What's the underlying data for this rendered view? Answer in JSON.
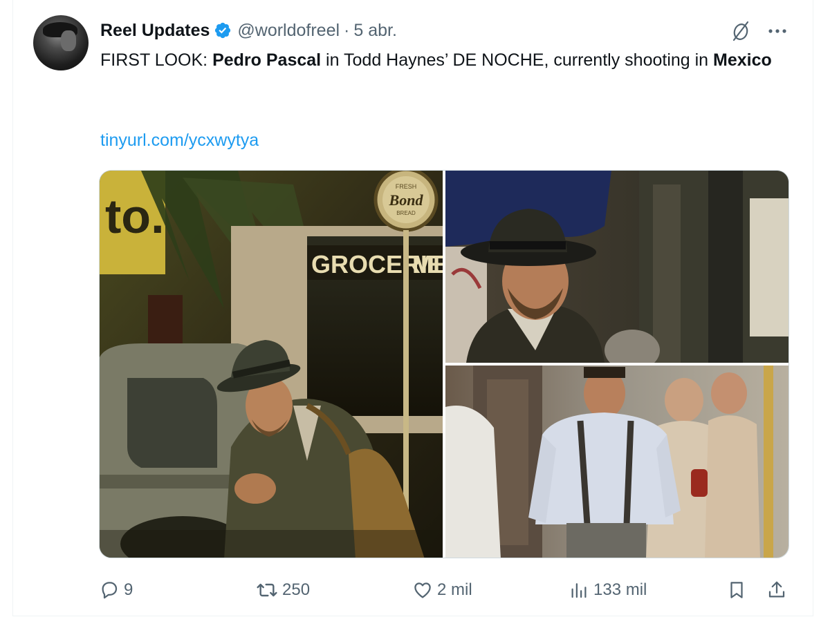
{
  "author": {
    "name": "Reel Updates",
    "handle": "@worldofreel",
    "separator": "·",
    "date": "5 abr.",
    "verified": true,
    "badge_color": "#1d9bf0",
    "avatar_icon": "avatar-image"
  },
  "tweet": {
    "text_parts": [
      {
        "text": "FIRST LOOK: ",
        "bold": false
      },
      {
        "text": "Pedro Pascal",
        "bold": true
      },
      {
        "text": " in Todd Haynes’ DE NOCHE, currently shooting in ",
        "bold": false
      },
      {
        "text": "Mexico",
        "bold": true
      }
    ],
    "link": "tinyurl.com/ycxwytya",
    "link_color": "#1d9bf0"
  },
  "media": {
    "photos": [
      {
        "label": "photo-left",
        "sign_text_1": "GROCERIES",
        "sign_text_2": "ME",
        "round_sign": "Bond",
        "round_sign_top": "FRESH",
        "round_sign_bottom": "BREAD"
      },
      {
        "label": "photo-top-right"
      },
      {
        "label": "photo-bottom-right"
      }
    ]
  },
  "actions": {
    "reply": {
      "icon": "reply-icon",
      "count": "9"
    },
    "retweet": {
      "icon": "retweet-icon",
      "count": "250"
    },
    "like": {
      "icon": "heart-icon",
      "count": "2 mil"
    },
    "views": {
      "icon": "views-icon",
      "count": "133 mil"
    },
    "bookmark": {
      "icon": "bookmark-icon"
    },
    "share": {
      "icon": "share-icon"
    }
  },
  "colors": {
    "text_primary": "#0f1419",
    "text_secondary": "#536471",
    "accent": "#1d9bf0"
  }
}
